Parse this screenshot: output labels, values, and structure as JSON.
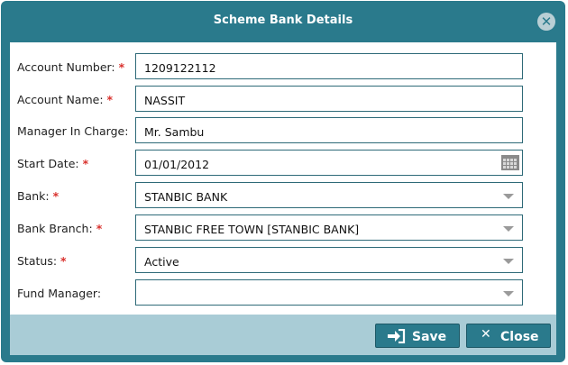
{
  "dialog": {
    "title": "Scheme Bank Details",
    "close_icon": "✕"
  },
  "fields": [
    {
      "label": "Account Number:",
      "required": true,
      "value": "1209122112",
      "type": "text"
    },
    {
      "label": "Account Name:",
      "required": true,
      "value": "NASSIT",
      "type": "text"
    },
    {
      "label": "Manager In Charge:",
      "required": false,
      "value": "Mr. Sambu",
      "type": "text"
    },
    {
      "label": "Start Date:",
      "required": true,
      "value": "01/01/2012",
      "type": "date"
    },
    {
      "label": "Bank:",
      "required": true,
      "value": "STANBIC BANK",
      "type": "select"
    },
    {
      "label": "Bank Branch:",
      "required": true,
      "value": "STANBIC FREE TOWN [STANBIC BANK]",
      "type": "select"
    },
    {
      "label": "Status:",
      "required": true,
      "value": "Active",
      "type": "select"
    },
    {
      "label": "Fund Manager:",
      "required": false,
      "value": "",
      "type": "select"
    }
  ],
  "required_marker": "*",
  "buttons": {
    "save_label": "Save",
    "close_label": "Close",
    "close_glyph": "✕"
  },
  "colors": {
    "header": "#2a7a8c",
    "footer": "#a9ccd6",
    "required": "#d9302c",
    "field_border": "#2e6a78"
  }
}
